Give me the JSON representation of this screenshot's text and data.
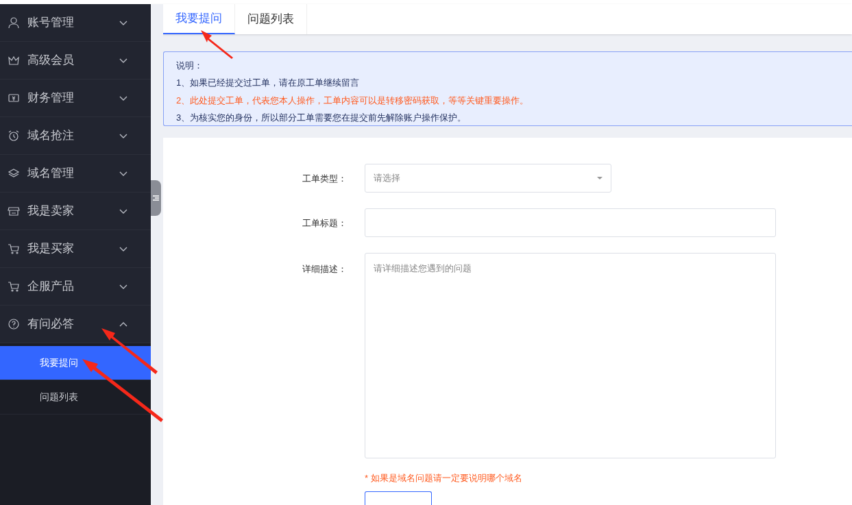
{
  "sidebar": {
    "items": [
      {
        "label": "账号管理",
        "expanded": false
      },
      {
        "label": "高级会员",
        "expanded": false
      },
      {
        "label": "财务管理",
        "expanded": false
      },
      {
        "label": "域名抢注",
        "expanded": false
      },
      {
        "label": "域名管理",
        "expanded": false
      },
      {
        "label": "我是卖家",
        "expanded": false
      },
      {
        "label": "我是买家",
        "expanded": false
      },
      {
        "label": "企服产品",
        "expanded": false
      },
      {
        "label": "有问必答",
        "expanded": true,
        "children": [
          {
            "label": "我要提问",
            "selected": true
          },
          {
            "label": "问题列表",
            "selected": false
          }
        ]
      }
    ]
  },
  "tabs": [
    {
      "label": "我要提问",
      "selected": true
    },
    {
      "label": "问题列表",
      "selected": false
    }
  ],
  "notice": {
    "title": "说明：",
    "lines": [
      {
        "text": "1、如果已经提交过工单，请在原工单继续留言",
        "kind": "normal"
      },
      {
        "text": "2、此处提交工单，代表您本人操作，工单内容可以是转移密码获取，等等关键重要操作。",
        "kind": "warning"
      },
      {
        "text": "3、为核实您的身份，所以部分工单需要您在提交前先解除账户操作保护。",
        "kind": "normal"
      }
    ]
  },
  "form": {
    "fields": [
      {
        "label": "工单类型：",
        "kind": "select",
        "placeholder": "请选择"
      },
      {
        "label": "工单标题：",
        "kind": "input"
      },
      {
        "label": "详细描述：",
        "kind": "textarea",
        "placeholder": "请详细描述您遇到的问题"
      }
    ],
    "hint": "* 如果是域名问题请一定要说明哪个域名"
  }
}
